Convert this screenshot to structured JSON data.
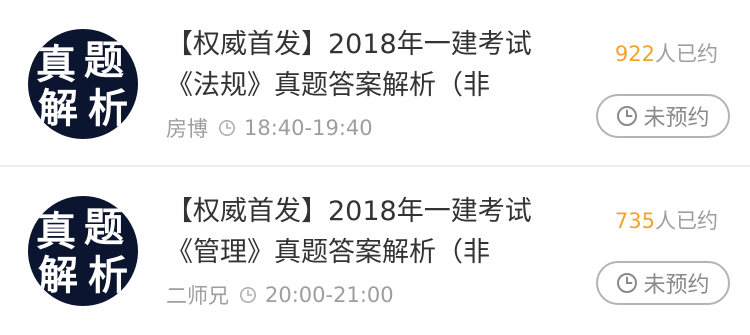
{
  "sessions": [
    {
      "thumbnail_text": [
        "真",
        "题",
        "解",
        "析"
      ],
      "title": "【权威首发】2018年一建考试《法规》真题答案解析（非",
      "lecturer": "房博",
      "time": "18:40-19:40",
      "booked_count": "922",
      "booked_label": "人已约",
      "status_label": "未预约",
      "icons": {
        "time": "clock-icon",
        "status": "clock-icon"
      }
    },
    {
      "thumbnail_text": [
        "真",
        "题",
        "解",
        "析"
      ],
      "title": "【权威首发】2018年一建考试《管理》真题答案解析（非",
      "lecturer": "二师兄",
      "time": "20:00-21:00",
      "booked_count": "735",
      "booked_label": "人已约",
      "status_label": "未预约",
      "icons": {
        "time": "clock-icon",
        "status": "clock-icon"
      }
    }
  ],
  "colors": {
    "thumbnail_bg": "#0c1530",
    "booked_count": "#f3a22c",
    "text_primary": "#333333",
    "text_secondary": "#9e9e9e"
  }
}
